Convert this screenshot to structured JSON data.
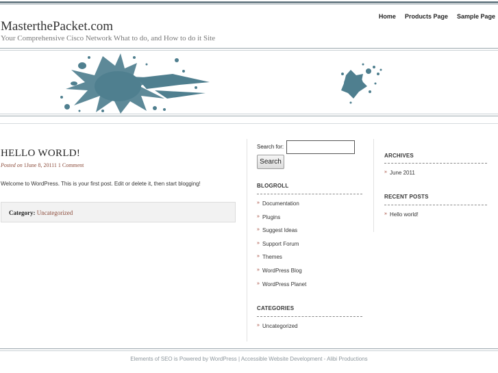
{
  "site": {
    "title": "MasterthePacket.com",
    "description": "Your Comprehensive Cisco Network What to do, and How to do it Site"
  },
  "nav": {
    "items": [
      "Home",
      "Products Page",
      "Sample Page"
    ]
  },
  "post": {
    "title": "HELLO WORLD!",
    "posted_on_label": "Posted on",
    "meta_text": "1June 8, 20111 1 Comment",
    "body": "Welcome to WordPress. This is your first post. Edit or delete it, then start blogging!",
    "category_label": "Category:",
    "category_value": "Uncategorized"
  },
  "search": {
    "label": "Search for:",
    "value": "",
    "button_label": "Search"
  },
  "blogroll": {
    "heading": "BLOGROLL",
    "items": [
      "Documentation",
      "Plugins",
      "Suggest Ideas",
      "Support Forum",
      "Themes",
      "WordPress Blog",
      "WordPress Planet"
    ]
  },
  "categories": {
    "heading": "CATEGORIES",
    "items": [
      "Uncategorized"
    ]
  },
  "archives": {
    "heading": "ARCHIVES",
    "items": [
      "June 2011"
    ]
  },
  "recent_posts": {
    "heading": "RECENT POSTS",
    "items": [
      "Hello world!"
    ]
  },
  "footer": {
    "text": "Elements of SEO is Powered by WordPress | Accessible Website Development - Alibi Productions"
  },
  "colors": {
    "accent": "#8b4b3a",
    "rule": "#6b7d86",
    "splash": "#4f7f8f"
  }
}
